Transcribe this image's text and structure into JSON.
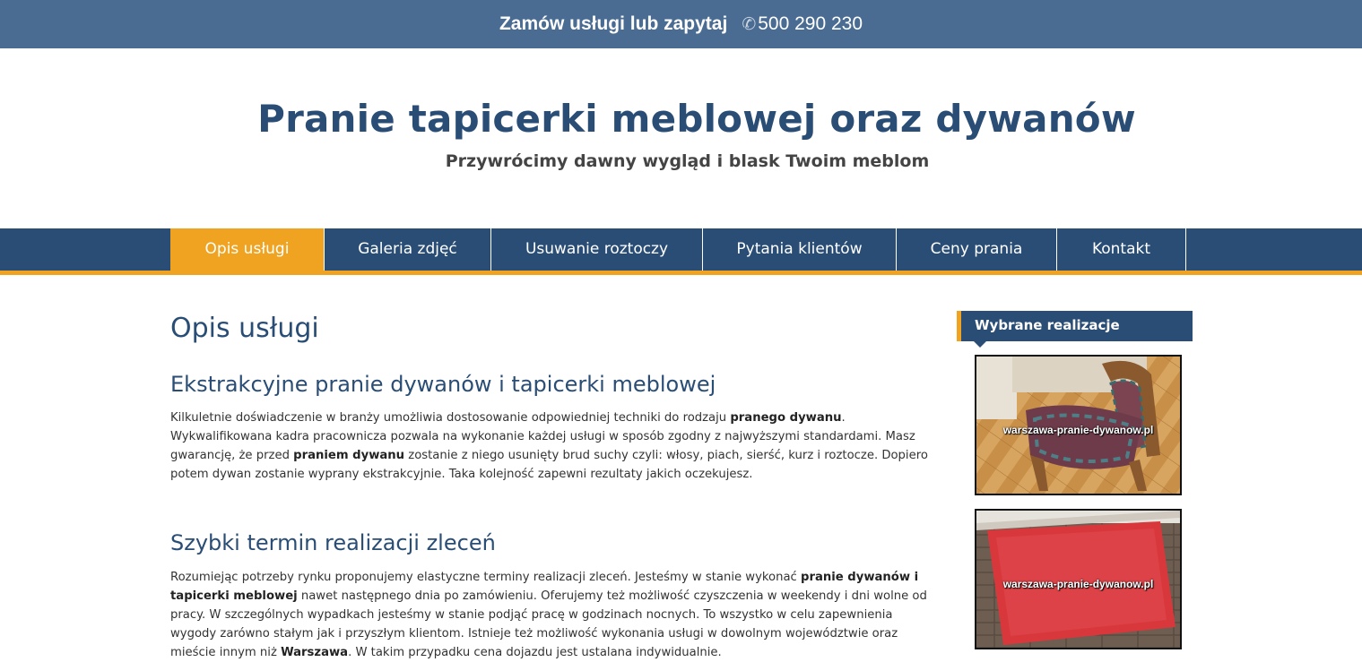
{
  "topbar": {
    "cta": "Zamów usługi lub zapytaj",
    "phone_icon": "phone-icon",
    "phone": "500 290 230"
  },
  "header": {
    "title": "Pranie tapicerki meblowej oraz dywanów",
    "subtitle": "Przywrócimy dawny wygląd i blask Twoim meblom"
  },
  "nav": {
    "items": [
      {
        "label": "Opis usługi"
      },
      {
        "label": "Galeria zdjęć"
      },
      {
        "label": "Usuwanie roztoczy"
      },
      {
        "label": "Pytania klientów"
      },
      {
        "label": "Ceny prania"
      },
      {
        "label": "Kontakt"
      }
    ],
    "active_color": "#f0a320",
    "bar_color": "#2a4d75"
  },
  "main": {
    "page_title": "Opis usługi",
    "sections": [
      {
        "heading": "Ekstrakcyjne pranie dywanów i tapicerki meblowej",
        "p1": "Kilkuletnie doświadczenie w branży umożliwia dostosowanie odpowiedniej techniki do rodzaju ",
        "b1": "pranego dywanu",
        "p2": ". Wykwalifikowana kadra pracownicza pozwala na wykonanie każdej usługi w sposób zgodny z najwyższymi standardami. Masz gwarancję, że przed ",
        "b2": "praniem dywanu",
        "p3": " zostanie z niego usunięty brud suchy czyli: włosy, piach, sierść, kurz i roztocze. Dopiero potem dywan zostanie wyprany ekstrakcyjnie. Taka kolejność zapewni rezultaty jakich oczekujesz."
      },
      {
        "heading": "Szybki termin realizacji zleceń",
        "p1": "Rozumiejąc potrzeby rynku proponujemy elastyczne terminy realizacji zleceń. Jesteśmy w stanie wykonać ",
        "b1": "pranie dywanów i tapicerki meblowej",
        "p2": " nawet następnego dnia po zamówieniu. Oferujemy też możliwość czyszczenia w weekendy i dni wolne od pracy. W szczególnych wypadkach jesteśmy w stanie podjąć pracę w godzinach nocnych. To wszystko w celu zapewnienia wygody zarówno stałym jak i przyszłym klientom. Istnieje też możliwość wykonania usługi w dowolnym województwie oraz mieście innym niż ",
        "b2": "Warszawa",
        "p3": ". W takim przypadku cena dojazdu jest ustalana indywidualnie."
      }
    ]
  },
  "sidebar": {
    "heading": "Wybrane realizacje",
    "images": [
      {
        "watermark": "warszawa-pranie-dywanow.pl"
      },
      {
        "watermark": "warszawa-pranie-dywanow.pl"
      }
    ]
  }
}
